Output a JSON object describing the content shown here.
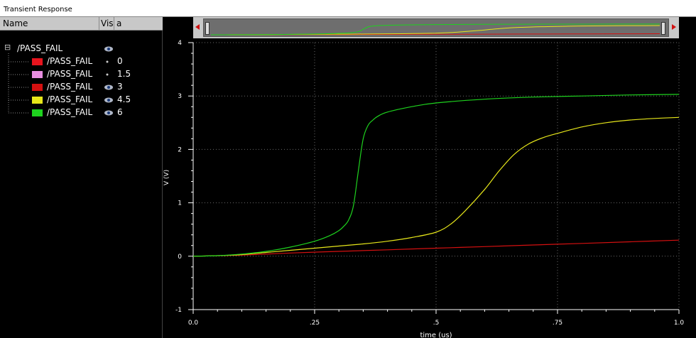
{
  "window": {
    "title": "Transient Response"
  },
  "columns": {
    "name": "Name",
    "vis": "Vis",
    "a": "a"
  },
  "tree": {
    "group": {
      "label": "/PASS_FAIL",
      "expander": "⊟"
    },
    "signals": [
      {
        "name": "/PASS_FAIL",
        "color": "#e8141e",
        "vis_icon": "dot-icon",
        "value": "0"
      },
      {
        "name": "/PASS_FAIL",
        "color": "#e88ee0",
        "vis_icon": "dot-icon",
        "value": "1.5"
      },
      {
        "name": "/PASS_FAIL",
        "color": "#d41010",
        "vis_icon": "eye-icon",
        "value": "3"
      },
      {
        "name": "/PASS_FAIL",
        "color": "#e6e61a",
        "vis_icon": "eye-icon",
        "value": "4.5"
      },
      {
        "name": "/PASS_FAIL",
        "color": "#1ed21e",
        "vis_icon": "eye-icon",
        "value": "6"
      }
    ]
  },
  "chart_data": {
    "type": "line",
    "title": "",
    "xlabel": "time (us)",
    "ylabel": "V (V)",
    "xlim": [
      0,
      1.0
    ],
    "ylim": [
      -1,
      4
    ],
    "xticks": [
      {
        "v": 0.0,
        "label": "0.0"
      },
      {
        "v": 0.25,
        "label": ".25"
      },
      {
        "v": 0.5,
        "label": ".5"
      },
      {
        "v": 0.75,
        "label": ".75"
      },
      {
        "v": 1.0,
        "label": "1.0"
      }
    ],
    "yticks": [
      {
        "v": -1,
        "label": "-1"
      },
      {
        "v": 0,
        "label": "0"
      },
      {
        "v": 1,
        "label": "1"
      },
      {
        "v": 2,
        "label": "2"
      },
      {
        "v": 3,
        "label": "3"
      },
      {
        "v": 4,
        "label": "4"
      }
    ],
    "grid": true,
    "series": [
      {
        "name": "/PASS_FAIL 3",
        "color": "#d41010",
        "x": [
          0,
          0.1,
          0.2,
          0.3,
          0.4,
          0.5,
          0.6,
          0.7,
          0.8,
          0.9,
          1.0
        ],
        "y": [
          0,
          0.02,
          0.06,
          0.09,
          0.12,
          0.15,
          0.18,
          0.21,
          0.24,
          0.27,
          0.3
        ]
      },
      {
        "name": "/PASS_FAIL 4.5",
        "color": "#e6e61a",
        "x": [
          0,
          0.05,
          0.1,
          0.15,
          0.2,
          0.25,
          0.3,
          0.35,
          0.4,
          0.45,
          0.5,
          0.53,
          0.56,
          0.6,
          0.63,
          0.66,
          0.69,
          0.72,
          0.75,
          0.8,
          0.85,
          0.9,
          0.95,
          1.0
        ],
        "y": [
          0,
          0.01,
          0.03,
          0.07,
          0.11,
          0.15,
          0.19,
          0.23,
          0.28,
          0.35,
          0.45,
          0.6,
          0.85,
          1.25,
          1.6,
          1.9,
          2.1,
          2.22,
          2.3,
          2.42,
          2.5,
          2.55,
          2.58,
          2.6
        ]
      },
      {
        "name": "/PASS_FAIL 6",
        "color": "#1ed21e",
        "x": [
          0,
          0.05,
          0.1,
          0.15,
          0.2,
          0.25,
          0.28,
          0.3,
          0.31,
          0.32,
          0.33,
          0.34,
          0.35,
          0.36,
          0.37,
          0.38,
          0.4,
          0.45,
          0.5,
          0.6,
          0.7,
          0.8,
          0.9,
          1.0
        ],
        "y": [
          0,
          0.01,
          0.04,
          0.09,
          0.17,
          0.28,
          0.38,
          0.48,
          0.56,
          0.68,
          0.95,
          1.6,
          2.2,
          2.45,
          2.55,
          2.62,
          2.7,
          2.8,
          2.87,
          2.94,
          2.98,
          3.0,
          3.02,
          3.03
        ]
      }
    ]
  }
}
